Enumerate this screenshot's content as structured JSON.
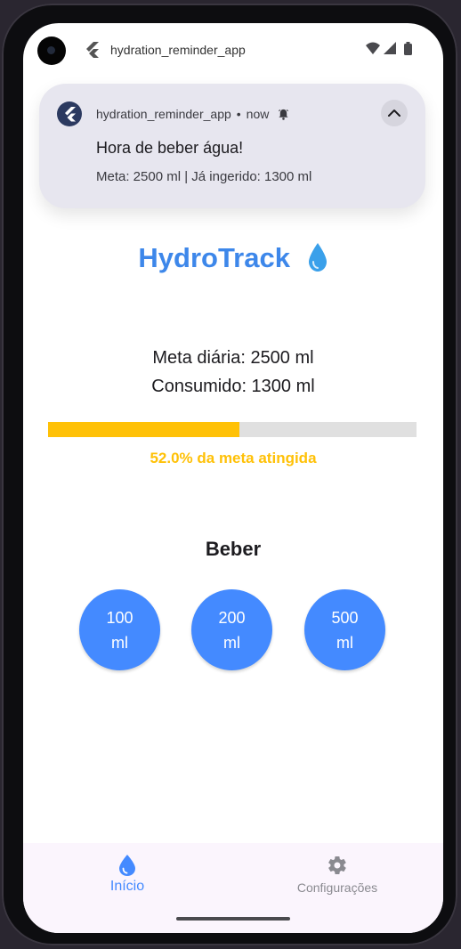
{
  "status_bar": {
    "app_name": "hydration_reminder_app"
  },
  "notification": {
    "app_name": "hydration_reminder_app",
    "separator": "•",
    "time": "now",
    "title": "Hora de beber água!",
    "body": "Meta: 2500 ml | Já ingerido: 1300 ml",
    "collapse_icon": "chevron-up-icon",
    "alert_icon": "bell-icon"
  },
  "main": {
    "title": "HydroTrack",
    "title_icon": "water-drop-icon",
    "goal_text": "Meta diária: 2500 ml",
    "consumed_text": "Consumido: 1300 ml",
    "progress": 0.52,
    "progress_label": "52.0% da meta atingida",
    "drink_heading": "Beber",
    "drink_buttons": [
      {
        "amount": "100",
        "unit": "ml"
      },
      {
        "amount": "200",
        "unit": "ml"
      },
      {
        "amount": "500",
        "unit": "ml"
      }
    ]
  },
  "bottom_nav": {
    "items": [
      {
        "label": "Início",
        "icon": "water-drop-icon",
        "active": true
      },
      {
        "label": "Configurações",
        "icon": "gear-icon",
        "active": false
      }
    ]
  },
  "colors": {
    "accent": "#448aff",
    "title": "#3d87ea",
    "progress": "#ffc107",
    "track": "#e0e0e0"
  }
}
